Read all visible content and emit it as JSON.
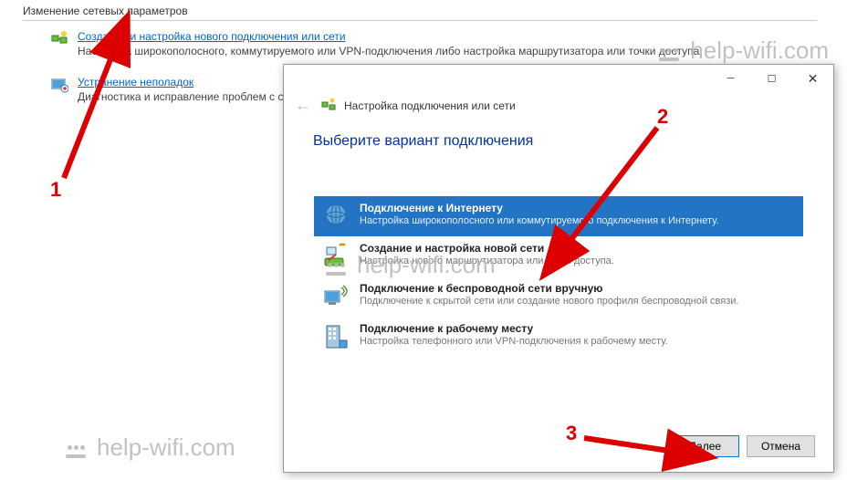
{
  "bg": {
    "section_title": "Изменение сетевых параметров",
    "links": [
      {
        "title": "Создание и настройка нового подключения или сети",
        "desc": "Настройка широкополосного, коммутируемого или VPN-подключения либо настройка маршрутизатора или точки доступа."
      },
      {
        "title": "Устранение неполадок",
        "desc": "Диагностика и исправление проблем с сетью или получение сведений об устранении неполадок."
      }
    ]
  },
  "dialog": {
    "title": "Настройка подключения или сети",
    "heading": "Выберите вариант подключения",
    "options": [
      {
        "title": "Подключение к Интернету",
        "desc": "Настройка широкополосного или коммутируемого подключения к Интернету.",
        "selected": true
      },
      {
        "title": "Создание и настройка новой сети",
        "desc": "Настройка нового маршрутизатора или точки доступа.",
        "selected": false
      },
      {
        "title": "Подключение к беспроводной сети вручную",
        "desc": "Подключение к скрытой сети или создание нового профиля беспроводной связи.",
        "selected": false
      },
      {
        "title": "Подключение к рабочему месту",
        "desc": "Настройка телефонного или VPN-подключения к рабочему месту.",
        "selected": false
      }
    ],
    "buttons": {
      "next": "Далее",
      "cancel": "Отмена"
    }
  },
  "watermark": "help-wifi.com",
  "annotations": {
    "n1": "1",
    "n2": "2",
    "n3": "3"
  }
}
